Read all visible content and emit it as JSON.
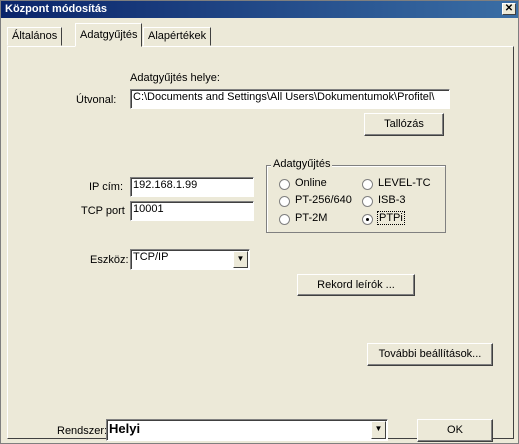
{
  "window": {
    "title": "Központ módosítás",
    "close_label": "✕"
  },
  "tabs": [
    {
      "label": "Általános"
    },
    {
      "label": "Adatgyűjtés"
    },
    {
      "label": "Alapértékek"
    }
  ],
  "path": {
    "heading": "Adatgyűjtés helye:",
    "label": "Útvonal:",
    "value": "C:\\Documents and Settings\\All Users\\Dokumentumok\\Profitel\\",
    "browse_label": "Tallózás"
  },
  "network": {
    "ip_label": "IP cím:",
    "ip_value": "192.168.1.99",
    "port_label": "TCP port",
    "port_value": "10001"
  },
  "collection_group": {
    "title": "Adatgyűjtés",
    "options": [
      {
        "label": "Online",
        "selected": false
      },
      {
        "label": "LEVEL-TC",
        "selected": false
      },
      {
        "label": "PT-256/640",
        "selected": false
      },
      {
        "label": "ISB-3",
        "selected": false
      },
      {
        "label": "PT-2M",
        "selected": false
      },
      {
        "label": "PTPi",
        "selected": true
      }
    ]
  },
  "device": {
    "label": "Eszköz:",
    "value": "TCP/IP"
  },
  "buttons": {
    "record_label": "Rekord leírók ...",
    "more_settings_label": "További beállítások...",
    "ok_label": "OK"
  },
  "system": {
    "label": "Rendszer:",
    "value": "Helyi"
  },
  "icons": {
    "dropdown": "▼"
  }
}
